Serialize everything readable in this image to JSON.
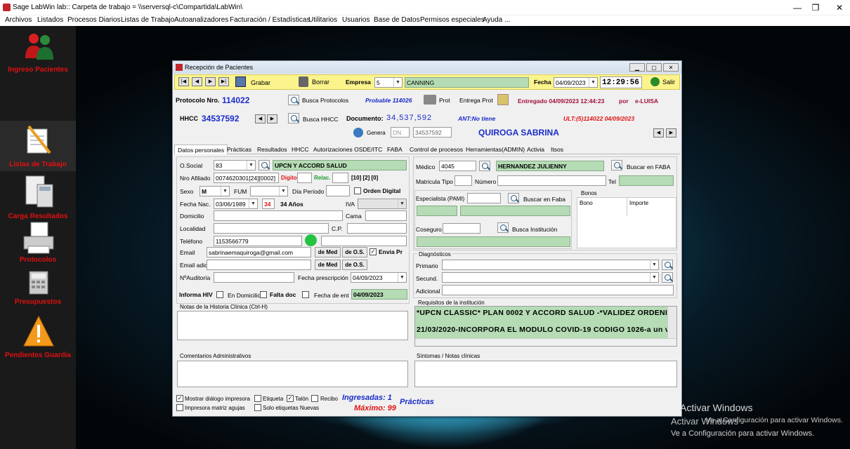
{
  "window": {
    "title": "Sage LabWin lab:: Carpeta de trabajo = \\\\serversql-c\\Compartida\\LabWin\\"
  },
  "menu": [
    "Archivos",
    "Listados",
    "Procesos Diarios",
    "Listas de Trabajo",
    "Autoanalizadores",
    "Facturación / Estadísticas",
    "Utilitarios",
    "Usuarios",
    "Base de Datos",
    "Permisos especiales",
    "Ayuda ..."
  ],
  "sidebar": [
    "Ingreso Pacientes",
    "Listas de Trabajo",
    "Carga Resultados",
    "Protocolos",
    "Presupuestos",
    "Pendientes Guardia"
  ],
  "dialog": {
    "title": "Recepción de Pacientes"
  },
  "toolbar": {
    "grabar": "Grabar",
    "borrar": "Borrar",
    "empresa_label": "Empresa",
    "empresa_value": "5",
    "empresa_name": "CANNING",
    "fecha_label": "Fecha",
    "fecha_value": "04/09/2023",
    "time": "12:29:56",
    "salir": "Salir"
  },
  "header": {
    "protocolo_label": "Protocolo Nro.",
    "protocolo_value": "114022",
    "busca_protocolos": "Busca Protocolos",
    "probable": "Probable 114026",
    "prot": "Prot",
    "entrega_prot": "Entrega Prot",
    "entregado": "Entregado 04/09/2023 12:44:23",
    "por": "por",
    "usuario": "e-LUISA",
    "hhcc_label": "HHCC",
    "hhcc_value": "34537592",
    "busca_hhcc": "Busca HHCC",
    "documento_label": "Documento:",
    "documento_value": "34,537,592",
    "ant": "ANT:No tiene",
    "ult": "ULT:(5)114022 04/09/2023",
    "genera": "Genera",
    "dni": "DN",
    "dni_value": "34537592",
    "patient_name": "QUIROGA SABRINA"
  },
  "tabs": [
    "Datos personales",
    "Prácticas",
    "Resultados",
    "HHCC",
    "Autorizaciones OSDE/ITC",
    "FABA",
    "Control de procesos",
    "Herramientas(ADMIN)",
    "Activia",
    "Itsos"
  ],
  "personal": {
    "osocial_label": "O.Social",
    "osocial_value": "83",
    "osocial_name": "UPCN  Y ACCORD SALUD",
    "nro_afiliado_label": "Nro Afiliado",
    "nro_afiliado_value": "0074620301[24][0002]",
    "digito": "Digito",
    "relac": "Relac.",
    "relac_codes": "[10] [2] [0]",
    "sexo_label": "Sexo",
    "sexo_value": "M",
    "fum_label": "FUM",
    "dia_periodo": "Día Período",
    "orden_digital": "Orden Digital",
    "fecha_nac_label": "Fecha Nac.",
    "fecha_nac_value": "03/06/1989",
    "edad_num": "34",
    "edad": "34 Años",
    "iva": "IVA",
    "domicilio": "Domicilio",
    "cama": "Cama",
    "localidad": "Localidad",
    "cp": "C.P.",
    "telefono_label": "Teléfono",
    "telefono_value": "1153566779",
    "email_label": "Email",
    "email_value": "sabrinaemaquiroga@gmail.com",
    "de_med": "de Med",
    "de_os": "de O.S.",
    "envia_pr": "Envia Pr",
    "email_adic": "Email adic.",
    "nauditoria": "NºAuditoría",
    "fecha_prescripcion_label": "Fecha prescripción",
    "fecha_prescripcion_value": "04/09/2023",
    "informa_hiv": "Informa HIV",
    "en_domicilio": "En Domicilio",
    "falta_doc": "Falta doc",
    "fecha_de_ent": "Fecha de ent",
    "fecha_de_ent_value": "04/09/2023",
    "notas_hc": "Notas de la Historia Clínica (Ctrl-H)",
    "comentarios": "Comentarios Administrativos"
  },
  "medico": {
    "medico_label": "Médico",
    "medico_value": "4045",
    "medico_name": "HERNANDEZ JULIENNY",
    "buscar_faba": "Buscar en FABA",
    "matricula_tipo": "Matricula Tipo",
    "numero": "Número",
    "tel": "Tel",
    "especialista": "Especialista (PAMI)",
    "buscar_faba2": "Buscar en Faba",
    "coseguro": "Coseguro",
    "busca_institucion": "Busca Institución",
    "bonos": "Bonos",
    "bono": "Bono",
    "importe": "Importe"
  },
  "diagnosticos": {
    "title": "Diagnósticos",
    "primario": "Primario",
    "secund": "Secund.",
    "adicional": "Adicional"
  },
  "requisitos": {
    "title": "Requisitos de la institución",
    "line1": "*UPCN CLASSIC* PLAN 0002 Y ACCORD SALUD -*VALIDEZ ORDENI",
    "line2": "21/03/2020-INCORPORA EL MODULO COVID-19 CODIGO 1026-a un v"
  },
  "sintomas": "Síntomas / Notas clínicas",
  "footer": {
    "mostrar_dialogo": "Mostrar diálogo impresora",
    "etiqueta": "Etiqueta",
    "talon": "Talón",
    "recibo": "Recibo",
    "impresora_matriz": "Impresora matriz agujas",
    "solo_etiquetas": "Solo etiquetas Nuevas",
    "ingresadas": "Ingresadas: 1",
    "practicas": "Prácticas",
    "maximo": "Máximo: 99"
  },
  "watermark": {
    "title": "Activar Windows",
    "line1": "Activar Windows",
    "line2": "Ve a Configuración para activar Windows.",
    "line3": "Ve a Configuración para activar Windows."
  }
}
